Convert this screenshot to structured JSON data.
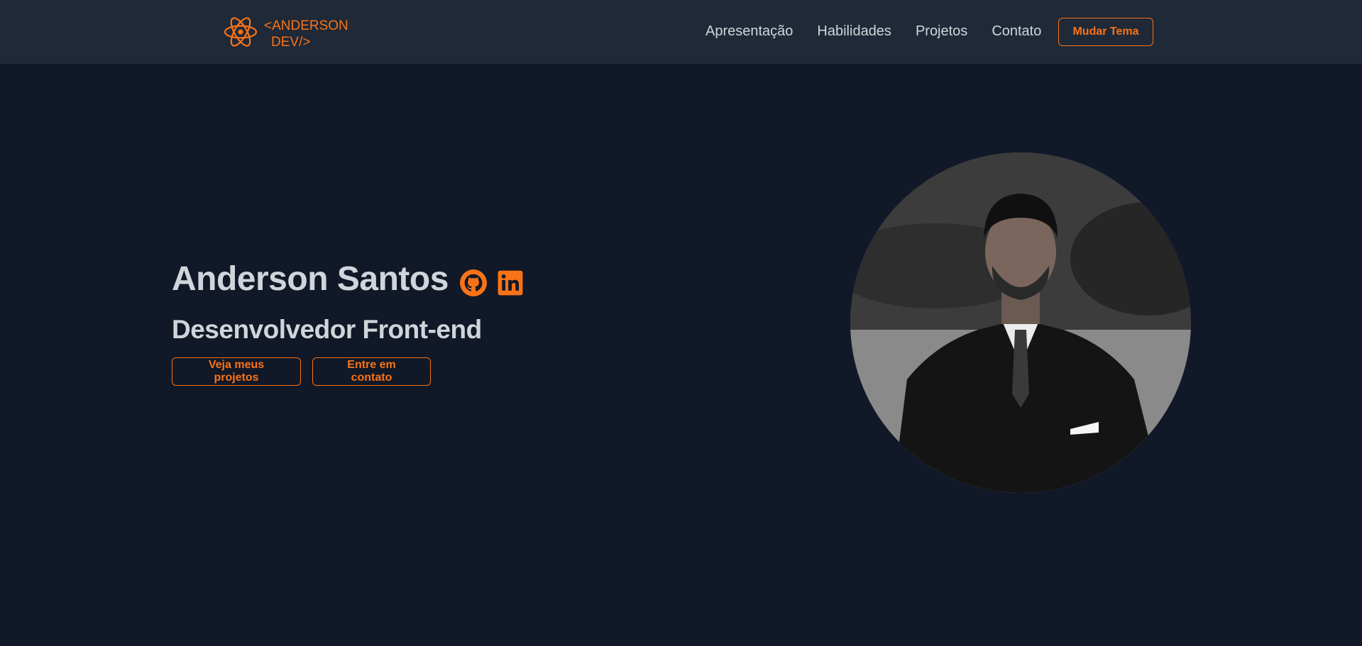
{
  "header": {
    "logo": {
      "icon": "react-atom-icon",
      "line1": "<ANDERSON",
      "line2": "DEV/>"
    },
    "nav": [
      {
        "label": "Apresentação"
      },
      {
        "label": "Habilidades"
      },
      {
        "label": "Projetos"
      },
      {
        "label": "Contato"
      }
    ],
    "theme_button": "Mudar Tema"
  },
  "hero": {
    "name": "Anderson Santos",
    "role": "Desenvolvedor Front-end",
    "social": [
      {
        "icon": "github-icon"
      },
      {
        "icon": "linkedin-icon"
      }
    ],
    "buttons": {
      "projects": "Veja meus projetos",
      "contact": "Entre em contato"
    },
    "photo": "profile-photo"
  },
  "colors": {
    "background": "#111827",
    "navbar": "#1f2937",
    "accent": "#f97316",
    "text": "#d1d5db"
  }
}
